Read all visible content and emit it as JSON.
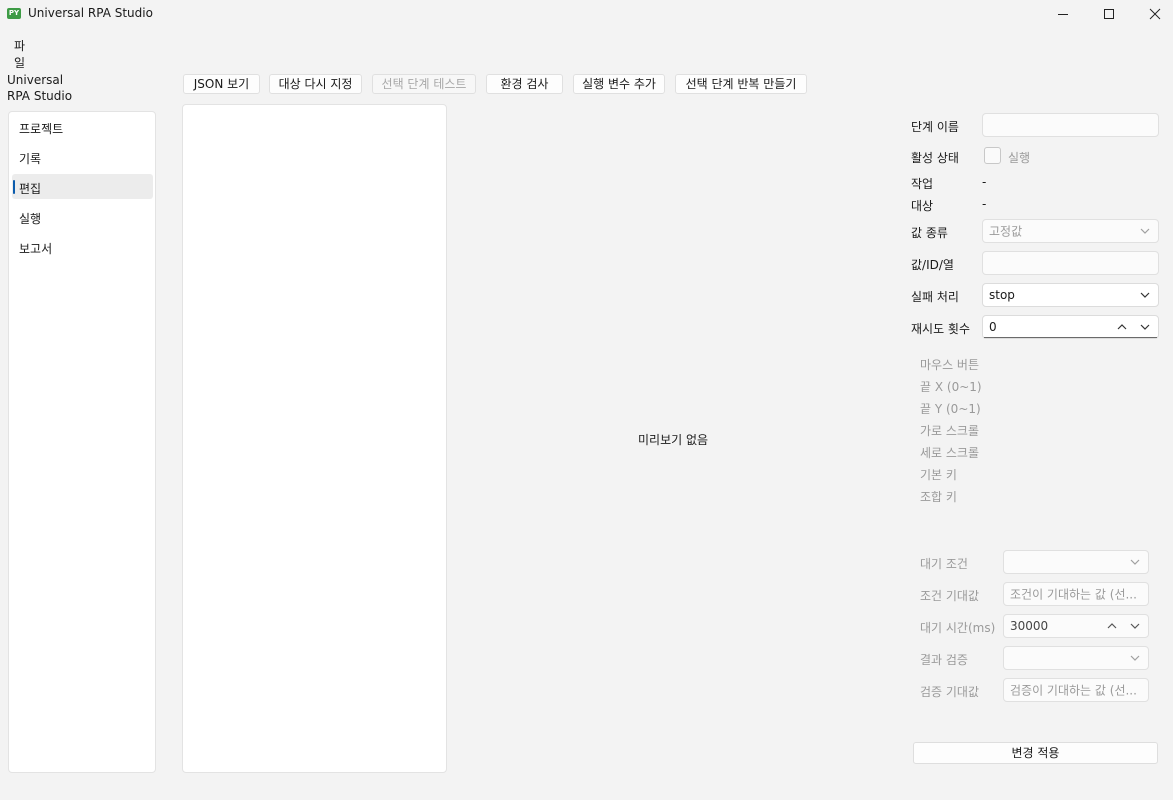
{
  "window": {
    "title": "Universal RPA Studio",
    "icon_text": "PY"
  },
  "menu": {
    "file": "파일"
  },
  "brand": {
    "line1": "Universal",
    "line2": "RPA Studio"
  },
  "sidebar": {
    "items": [
      {
        "label": "프로젝트"
      },
      {
        "label": "기록"
      },
      {
        "label": "편집",
        "active": true
      },
      {
        "label": "실행"
      },
      {
        "label": "보고서"
      }
    ]
  },
  "toolbar": {
    "json_view": "JSON 보기",
    "retarget": "대상 다시 지정",
    "test_step": "선택 단계 테스트",
    "env_check": "환경 검사",
    "add_var": "실행 변수 추가",
    "make_loop": "선택 단계 반복 만들기"
  },
  "preview": {
    "empty_text": "미리보기 없음"
  },
  "props": {
    "step_name_label": "단계 이름",
    "step_name_value": "",
    "active_label": "활성 상태",
    "active_checkbox_text": "실행",
    "action_label": "작업",
    "action_value": "-",
    "target_label": "대상",
    "target_value": "-",
    "value_type_label": "값 종류",
    "value_type_value": "고정값",
    "value_label": "값/ID/열",
    "value_value": "",
    "failure_label": "실패 처리",
    "failure_value": "stop",
    "retry_label": "재시도 횟수",
    "retry_value": "0",
    "mouse_button_label": "마우스 버튼",
    "end_x_label": "끝 X (0~1)",
    "end_y_label": "끝 Y (0~1)",
    "hscroll_label": "가로 스크롤",
    "vscroll_label": "세로 스크롤",
    "base_key_label": "기본 키",
    "combo_key_label": "조합 키",
    "wait_cond_label": "대기 조건",
    "cond_expected_label": "조건 기대값",
    "cond_expected_placeholder": "조건이 기대하는 값 (선...",
    "wait_time_label": "대기 시간(ms)",
    "wait_time_value": "30000",
    "verify_label": "결과 검증",
    "verify_expected_label": "검증 기대값",
    "verify_expected_placeholder": "검증이 기대하는 값 (선...",
    "apply_button": "변경 적용"
  },
  "colors": {
    "accent": "#0b5cad",
    "background": "#f3f3f3",
    "panel": "#ffffff",
    "disabled_text": "#9a9a9a"
  }
}
